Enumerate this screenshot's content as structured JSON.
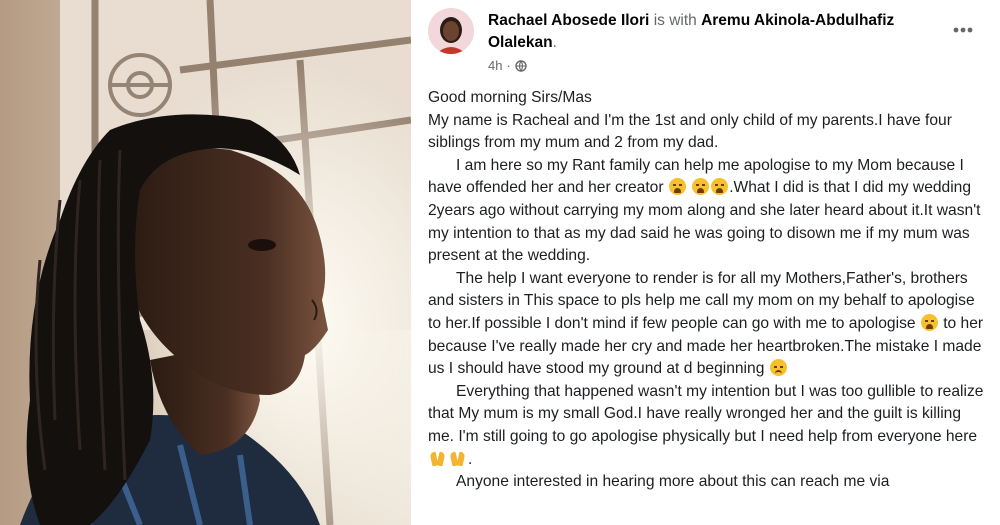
{
  "post": {
    "author": "Rachael Abosede Ilori",
    "with_text": "is with",
    "tagged": "Aremu Akinola-Abdulhafiz Olalekan",
    "tagged_suffix": ".",
    "time": "4h",
    "separator": "·",
    "audience_icon": "globe-icon",
    "more_icon": "more-options-icon",
    "paragraphs": [
      {
        "text": "Good morning Sirs/Mas"
      },
      {
        "text": "My name is Racheal and I'm the 1st and only child of my parents.I have four siblings from my mum and 2 from my dad."
      },
      {
        "a": "I am here so my Rant family can help me apologise to my Mom because I have offended her and her creator ",
        "b": ".What I did is that I did my wedding 2years ago without carrying my mom along and she later heard about it.It wasn't my intention to that as my dad said he was going to disown me if my mum was present at the wedding."
      },
      {
        "a": "The help I want everyone to render is for all my Mothers,Father's, brothers and sisters in This space to pls help me call my mom on my behalf to apologise to her.If possible I don't mind if few people can go with me to apologise ",
        "b": " to her because I've really made her cry and made her heartbroken.The mistake I made us I should have stood my ground at d beginning "
      },
      {
        "a": "Everything that happened wasn't my intention but I was too gullible to realize that My mum is my small God.I have really wronged her and the guilt is killing me. I'm still going to go apologise physically but I need help from everyone here",
        "b": "."
      },
      {
        "text": "Anyone interested in hearing more about this can reach me via"
      }
    ],
    "emoji": {
      "crying": "loudly-crying-face-emoji",
      "pensive": "pensive-face-emoji",
      "praying": "folded-hands-emoji"
    }
  },
  "colors": {
    "text": "#1c1e21",
    "muted": "#65676b",
    "avatar_bg": "#f3d8db"
  }
}
